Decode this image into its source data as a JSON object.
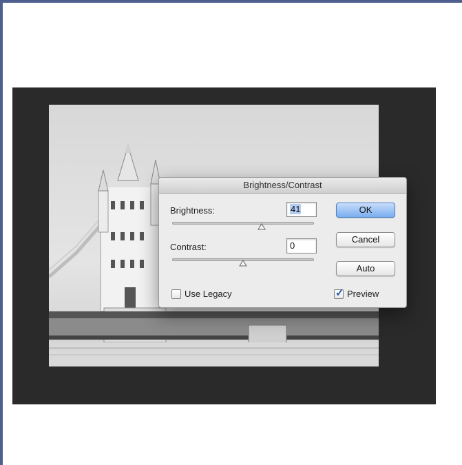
{
  "dialog": {
    "title": "Brightness/Contrast",
    "brightness_label": "Brightness:",
    "brightness_value": "41",
    "contrast_label": "Contrast:",
    "contrast_value": "0",
    "use_legacy_label": "Use Legacy",
    "use_legacy_checked": false,
    "preview_label": "Preview",
    "preview_checked": true,
    "buttons": {
      "ok": "OK",
      "cancel": "Cancel",
      "auto": "Auto"
    }
  },
  "colors": {
    "frame_border": "#4e5f8e",
    "workspace_bg": "#2a2a2a",
    "ok_button": "#7aaef0",
    "checkmark": "#1d56b3"
  }
}
